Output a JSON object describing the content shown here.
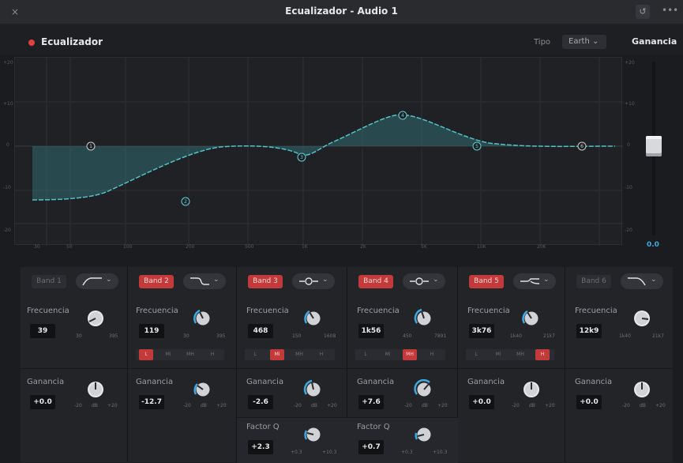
{
  "window": {
    "title": "Ecualizador - Audio 1",
    "close_glyph": "×",
    "more_glyph": "•••",
    "reset_glyph": "↺"
  },
  "header": {
    "eq_label": "Ecualizador",
    "tipo_label": "Tipo",
    "tipo_value": "Earth ⌄",
    "gain_label": "Ganancia"
  },
  "graph": {
    "db_ticks_left": [
      "+20",
      "+10",
      "0",
      "-10",
      "-20"
    ],
    "db_ticks_right": [
      "+20",
      "+10",
      "0",
      "-10",
      "-20"
    ],
    "freq_ticks": [
      "30",
      "50",
      "100",
      "200",
      "500",
      "1K",
      "2K",
      "5K",
      "10K",
      "20K"
    ],
    "node_labels": [
      "1",
      "2",
      "3",
      "4",
      "5",
      "6"
    ],
    "curve_color": "#4fc3c9"
  },
  "gain": {
    "value": "0.0"
  },
  "bands": [
    {
      "label": "Band 1",
      "active": false,
      "freq_label": "Frecuencia",
      "freq_value": "39",
      "freq_min": "30",
      "freq_max": "395",
      "gain_label": "Ganancia",
      "gain_value": "+0.0",
      "gain_min": "-20",
      "gain_unit": "dB",
      "gain_max": "+20"
    },
    {
      "label": "Band 2",
      "active": true,
      "freq_label": "Frecuencia",
      "freq_value": "119",
      "freq_min": "30",
      "freq_max": "395",
      "modes": [
        "L",
        "Mi",
        "MH",
        "H"
      ],
      "mode_active": 0,
      "gain_label": "Ganancia",
      "gain_value": "-12.7",
      "gain_min": "-20",
      "gain_unit": "dB",
      "gain_max": "+20"
    },
    {
      "label": "Band 3",
      "active": true,
      "freq_label": "Frecuencia",
      "freq_value": "468",
      "freq_min": "150",
      "freq_max": "1608",
      "modes": [
        "L",
        "Mi",
        "MH",
        "H"
      ],
      "mode_active": 1,
      "gain_label": "Ganancia",
      "gain_value": "-2.6",
      "gain_min": "-20",
      "gain_unit": "dB",
      "gain_max": "+20",
      "q_label": "Factor Q",
      "q_value": "+2.3",
      "q_min": "+0.3",
      "q_max": "+10.3"
    },
    {
      "label": "Band 4",
      "active": true,
      "freq_label": "Frecuencia",
      "freq_value": "1k56",
      "freq_min": "450",
      "freq_max": "7891",
      "modes": [
        "L",
        "Mi",
        "MH",
        "H"
      ],
      "mode_active": 2,
      "gain_label": "Ganancia",
      "gain_value": "+7.6",
      "gain_min": "-20",
      "gain_unit": "dB",
      "gain_max": "+20",
      "q_label": "Factor Q",
      "q_value": "+0.7",
      "q_min": "+0.3",
      "q_max": "+10.3"
    },
    {
      "label": "Band 5",
      "active": true,
      "freq_label": "Frecuencia",
      "freq_value": "3k76",
      "freq_min": "1k40",
      "freq_max": "21k7",
      "modes": [
        "L",
        "Mi",
        "MH",
        "H"
      ],
      "mode_active": 3,
      "gain_label": "Ganancia",
      "gain_value": "+0.0",
      "gain_min": "-20",
      "gain_unit": "dB",
      "gain_max": "+20"
    },
    {
      "label": "Band 6",
      "active": false,
      "freq_label": "Frecuencia",
      "freq_value": "12k9",
      "freq_min": "1k40",
      "freq_max": "21k7",
      "gain_label": "Ganancia",
      "gain_value": "+0.0",
      "gain_min": "-20",
      "gain_unit": "dB",
      "gain_max": "+20"
    }
  ]
}
